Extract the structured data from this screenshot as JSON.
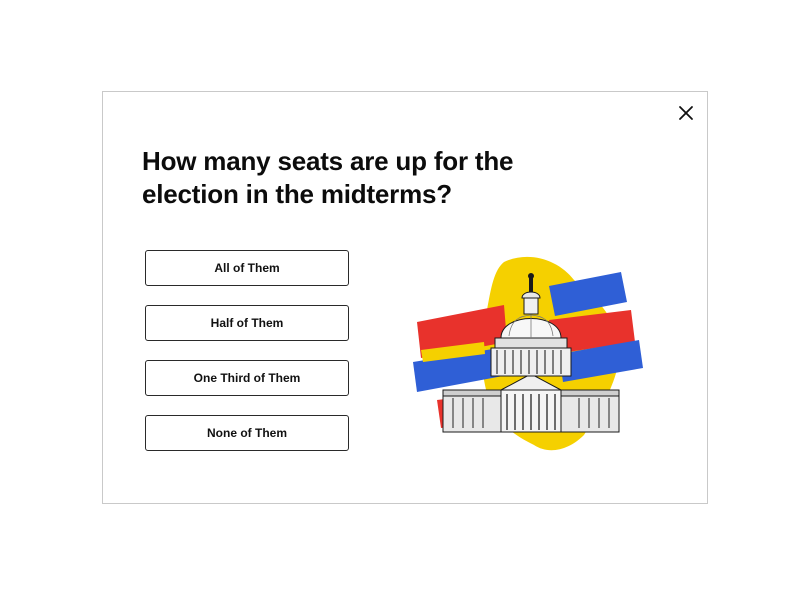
{
  "quiz": {
    "question": "How many seats are up for the election in the midterms?",
    "options": [
      {
        "label": "All of Them"
      },
      {
        "label": "Half of Them"
      },
      {
        "label": "One Third of Them"
      },
      {
        "label": "None of Them"
      }
    ]
  },
  "icons": {
    "close": "close-icon",
    "illustration": "capitol-building-illustration"
  },
  "colors": {
    "red": "#e8322c",
    "blue": "#2f5fd6",
    "yellow": "#f5d000",
    "text": "#0c0c0c",
    "border": "#2a2a2a"
  }
}
